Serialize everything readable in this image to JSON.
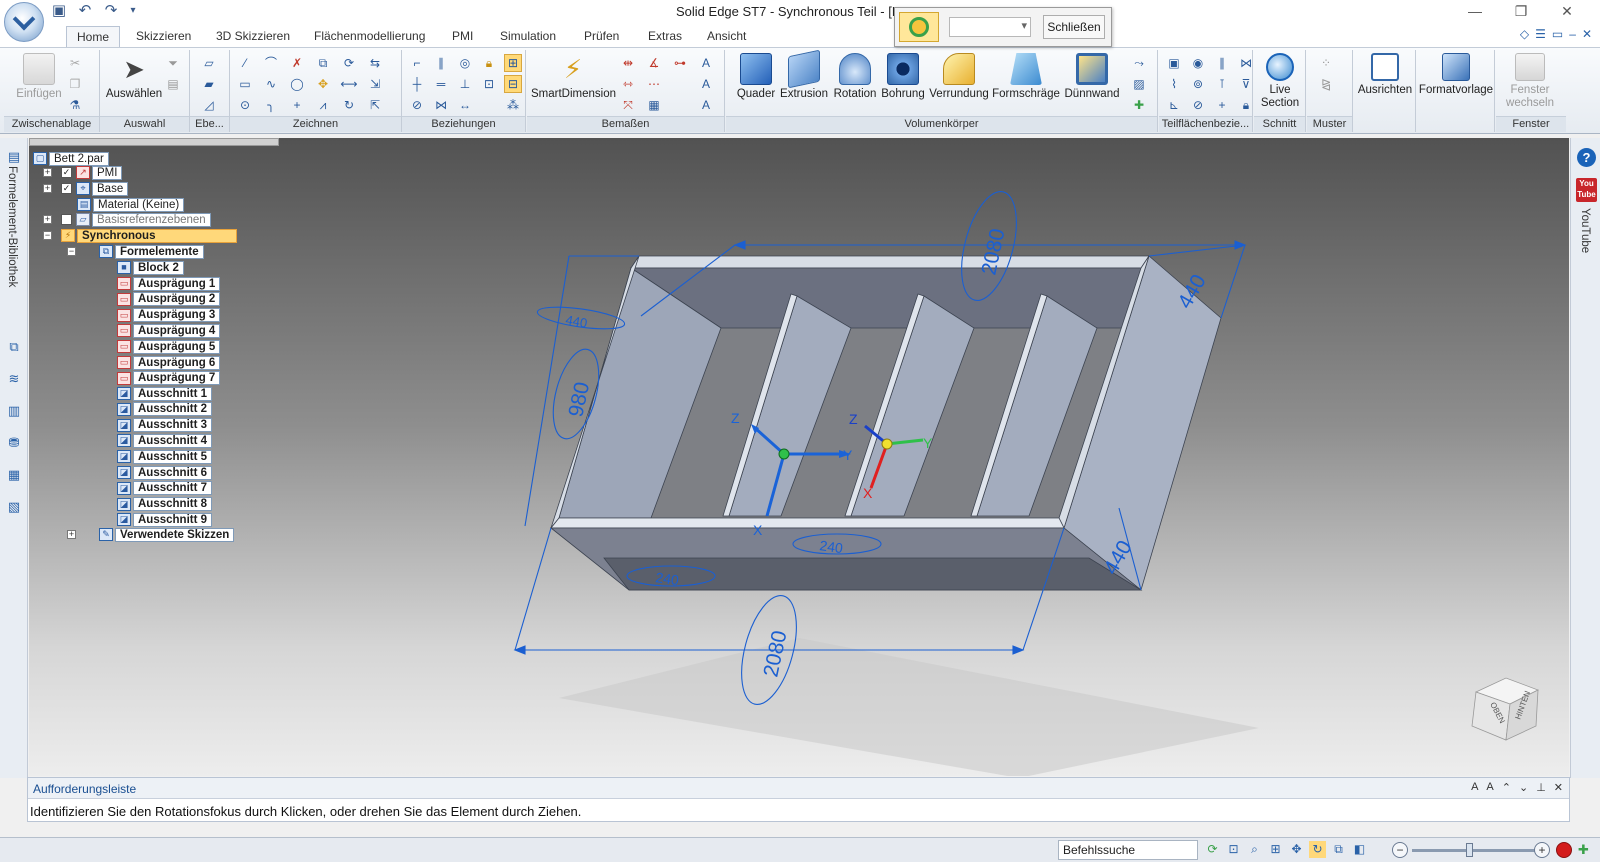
{
  "window": {
    "title": "Solid Edge ST7 - Synchronous Teil - [Bett",
    "controls": [
      "—",
      "❐",
      "✕"
    ]
  },
  "quick_access": {
    "icons": [
      "save-icon",
      "undo-icon",
      "redo-icon",
      "customize-icon"
    ]
  },
  "command_popup": {
    "close_label": "Schließen",
    "combo_value": ""
  },
  "tabs": [
    {
      "label": "Home",
      "active": true
    },
    {
      "label": "Skizzieren"
    },
    {
      "label": "3D Skizzieren"
    },
    {
      "label": "Flächenmodellierung"
    },
    {
      "label": "PMI"
    },
    {
      "label": "Simulation"
    },
    {
      "label": "Prüfen"
    },
    {
      "label": "Extras"
    },
    {
      "label": "Ansicht"
    }
  ],
  "mdi_controls": [
    "◇",
    "☰",
    "▭",
    "–",
    "✕"
  ],
  "ribbon": {
    "groups": {
      "zwischenablage": "Zwischenablage",
      "auswahl": "Auswahl",
      "ebene": "Ebe...",
      "zeichnen": "Zeichnen",
      "beziehungen": "Beziehungen",
      "bemassen": "Bemaßen",
      "volumenkoerper": "Volumenkörper",
      "teilflaechen": "Teilflächenbezie...",
      "schnitt": "Schnitt",
      "muster": "Muster",
      "fenster": "Fenster"
    },
    "buttons": {
      "einfuegen": "Einfügen",
      "auswaehlen": "Auswählen",
      "smartdimension": "SmartDimension",
      "quader": "Quader",
      "extrusion": "Extrusion",
      "rotation": "Rotation",
      "bohrung": "Bohrung",
      "verrundung": "Verrundung",
      "formschraege": "Formschräge",
      "duennwand": "Dünnwand",
      "live_section_1": "Live",
      "live_section_2": "Section",
      "ausrichten": "Ausrichten",
      "formatvorlage": "Formatvorlage",
      "fenster_wechseln_1": "Fenster",
      "fenster_wechseln_2": "wechseln"
    }
  },
  "left_bar": {
    "label": "Formelement-Bibliothek"
  },
  "right_bar": {
    "label": "YouTube",
    "help": "?",
    "yt_top": "You",
    "yt_bottom": "Tube"
  },
  "tree": {
    "root": "Bett 2.par",
    "pmi": "PMI",
    "base": "Base",
    "material": "Material (Keine)",
    "basisref": "Basisreferenzebenen",
    "synchronous": "Synchronous",
    "formelemente": "Formelemente",
    "block": "Block 2",
    "auspraegungen": [
      "Ausprägung 1",
      "Ausprägung 2",
      "Ausprägung 3",
      "Ausprägung 4",
      "Ausprägung 5",
      "Ausprägung 6",
      "Ausprägung 7"
    ],
    "ausschnitte": [
      "Ausschnitt 1",
      "Ausschnitt 2",
      "Ausschnitt 3",
      "Ausschnitt 4",
      "Ausschnitt 5",
      "Ausschnitt 6",
      "Ausschnitt 7",
      "Ausschnitt 8",
      "Ausschnitt 9"
    ],
    "skizzen": "Verwendete Skizzen"
  },
  "dimensions": {
    "top_length": "2080",
    "bottom_length": "2080",
    "width_left": "980",
    "top_right_depth": "440",
    "bottom_right_depth": "440",
    "top_left_small": "440",
    "mid_bottom": "240",
    "left_bottom": "240"
  },
  "axes": {
    "z": "Z",
    "y": "Y",
    "x": "X"
  },
  "viewcube": {
    "top": "OBEN",
    "back": "HINTEN"
  },
  "prompt": {
    "title": "Aufforderungsleiste",
    "message": "Identifizieren Sie den Rotationsfokus durch Klicken, oder drehen Sie das Element durch Ziehen."
  },
  "status": {
    "search_placeholder": "Befehlssuche"
  },
  "colors": {
    "accent": "#1a63b8",
    "dimension": "#1b5fd1",
    "selection": "#ffd87a"
  }
}
